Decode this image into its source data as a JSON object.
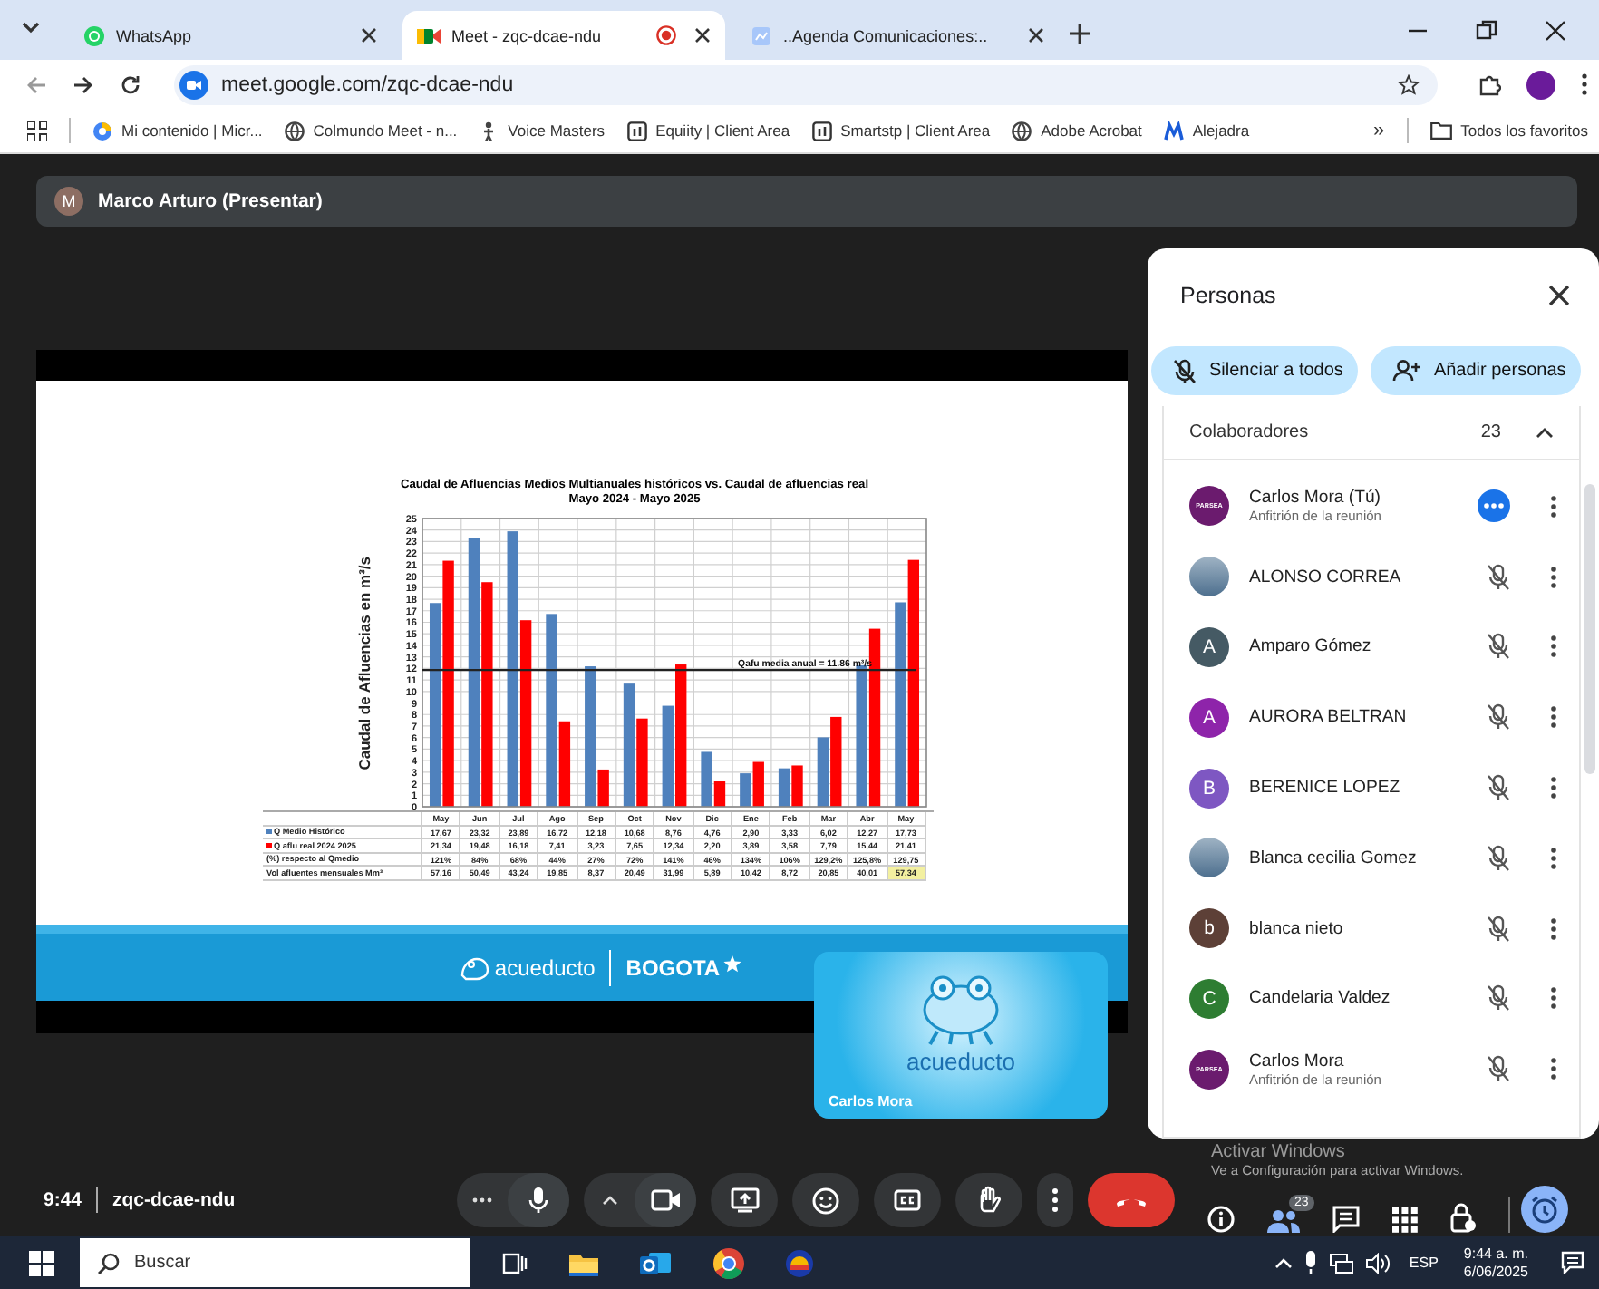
{
  "browser": {
    "tabs": [
      {
        "title": "WhatsApp",
        "kind": "chat",
        "selected": false,
        "recording": false
      },
      {
        "title": "Meet - zqc-dcae-ndu",
        "kind": "video",
        "selected": true,
        "recording": true
      },
      {
        "title": "..Agenda Comunicaciones:..",
        "kind": "page",
        "selected": false,
        "recording": false
      }
    ],
    "url": "meet.google.com/zqc-dcae-ndu",
    "bookmarks": [
      {
        "label": "Mi contenido | Micr...",
        "kind": "colorful"
      },
      {
        "label": "Colmundo Meet - n...",
        "kind": "globe"
      },
      {
        "label": "Voice Masters",
        "kind": "figure"
      },
      {
        "label": "Equiity | Client Area",
        "kind": "square"
      },
      {
        "label": "Smartstp | Client Area",
        "kind": "square"
      },
      {
        "label": "Adobe Acrobat",
        "kind": "globe"
      },
      {
        "label": "Alejadra",
        "kind": "m"
      }
    ],
    "bookmarks_more": "»",
    "all_bookmarks": "Todos los favoritos"
  },
  "presenter": {
    "initial": "M",
    "label": "Marco Arturo (Presentar)"
  },
  "slide": {
    "chart_data": {
      "type": "bar",
      "title": "Caudal de Afluencias Medios Multianuales históricos vs. Caudal de afluencias real",
      "subtitle": "Mayo 2024 - Mayo 2025",
      "ylabel": "Caudal de Afluencias en m³/s",
      "categories": [
        "May",
        "Jun",
        "Jul",
        "Ago",
        "Sep",
        "Oct",
        "Nov",
        "Dic",
        "Ene",
        "Feb",
        "Mar",
        "Abr",
        "May"
      ],
      "series": [
        {
          "name": "Q Medio Histórico",
          "color": "#4f81bd",
          "values": [
            17.67,
            23.32,
            23.89,
            16.72,
            12.18,
            10.68,
            8.76,
            4.76,
            2.9,
            3.33,
            6.02,
            12.27,
            17.73
          ]
        },
        {
          "name": "Q aflu real 2024 2025",
          "color": "#ff0000",
          "values": [
            21.34,
            19.48,
            16.18,
            7.41,
            3.23,
            7.65,
            12.34,
            2.2,
            3.89,
            3.58,
            7.79,
            15.44,
            21.41
          ]
        }
      ],
      "ylim": [
        0,
        25
      ],
      "yticks": [
        0,
        1,
        2,
        3,
        4,
        5,
        6,
        7,
        8,
        9,
        10,
        11,
        12,
        13,
        14,
        15,
        16,
        17,
        18,
        19,
        20,
        21,
        22,
        23,
        24,
        25
      ],
      "grid": true,
      "legend": "bottom left",
      "ref_lines": [
        {
          "axis": "y",
          "value": 11.86,
          "label": "Qafu media anual = 11.86 m³/s"
        }
      ]
    },
    "table": {
      "rows": [
        {
          "kind": "series",
          "cells": [
            "17,67",
            "23,32",
            "23,89",
            "16,72",
            "12,18",
            "10,68",
            "8,76",
            "4,76",
            "2,90",
            "3,33",
            "6,02",
            "12,27",
            "17,73"
          ]
        },
        {
          "kind": "series",
          "cells": [
            "21,34",
            "19,48",
            "16,18",
            "7,41",
            "3,23",
            "7,65",
            "12,34",
            "2,20",
            "3,89",
            "3,58",
            "7,79",
            "15,44",
            "21,41"
          ]
        },
        {
          "kind": "plain",
          "label": "(%)  respecto al Qmedio",
          "cells": [
            "121%",
            "84%",
            "68%",
            "44%",
            "27%",
            "72%",
            "141%",
            "46%",
            "134%",
            "106%",
            "129,2%",
            "125,8%",
            "129,75"
          ]
        },
        {
          "kind": "plain",
          "label": "Vol afluentes mensuales Mm³",
          "highlighted_last": true,
          "cells": [
            "57,16",
            "50,49",
            "43,24",
            "19,85",
            "8,37",
            "20,49",
            "31,99",
            "5,89",
            "10,42",
            "8,72",
            "20,85",
            "40,01",
            "57,34"
          ]
        }
      ]
    },
    "footer": {
      "brand": "acueducto",
      "city": "BOGOTA"
    }
  },
  "self_view": {
    "logo_text": "acueducto",
    "name": "Carlos Mora"
  },
  "people_panel": {
    "title": "Personas",
    "buttons": [
      {
        "kind": "mute",
        "label": "Silenciar a todos"
      },
      {
        "kind": "add",
        "label": "Añadir personas"
      }
    ],
    "section": {
      "title": "Colaboradores",
      "count": "23",
      "expanded": true
    },
    "participants": [
      {
        "name": "Carlos Mora (Tú)",
        "role": "Anfitrión de la reunión",
        "avatar": {
          "kind": "logo",
          "text": "PARSEA"
        },
        "muted": false
      },
      {
        "name": "ALONSO CORREA",
        "avatar": {
          "kind": "photo"
        },
        "muted": true
      },
      {
        "name": "Amparo Gómez",
        "avatar": {
          "kind": "letter",
          "initial": "A",
          "color": "#455a64"
        },
        "muted": true
      },
      {
        "name": "AURORA BELTRAN",
        "avatar": {
          "kind": "letter",
          "initial": "A",
          "color": "#8e24aa"
        },
        "muted": true
      },
      {
        "name": "BERENICE LOPEZ",
        "avatar": {
          "kind": "letter",
          "initial": "B",
          "color": "#7e57c2"
        },
        "muted": true
      },
      {
        "name": "Blanca cecilia Gomez",
        "avatar": {
          "kind": "photo"
        },
        "muted": true
      },
      {
        "name": "blanca nieto",
        "avatar": {
          "kind": "letter",
          "initial": "b",
          "color": "#5d4037"
        },
        "muted": true
      },
      {
        "name": "Candelaria Valdez",
        "avatar": {
          "kind": "letter",
          "initial": "C",
          "color": "#2e7d32"
        },
        "muted": true
      },
      {
        "name": "Carlos Mora",
        "role": "Anfitrión de la reunión",
        "avatar": {
          "kind": "logo",
          "text": "PARSEA"
        },
        "muted": true
      }
    ]
  },
  "bottom_bar": {
    "time": "9:44",
    "meeting_code": "zqc-dcae-ndu",
    "people_count": "23"
  },
  "windows_notice": {
    "title": "Activar Windows",
    "text": "Ve a Configuración para activar Windows."
  },
  "taskbar": {
    "search_placeholder": "Buscar",
    "language": "ESP",
    "time": "9:44 a. m.",
    "date": "6/06/2025"
  }
}
